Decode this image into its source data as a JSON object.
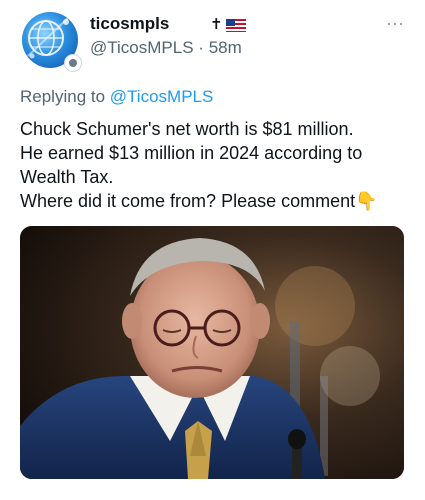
{
  "tweet": {
    "display_name": "ticosmpls",
    "name_badges": "✝",
    "handle": "@TicosMPLS",
    "separator": "·",
    "time": "58m",
    "reply_prefix": "Replying to",
    "reply_mention": "@TicosMPLS",
    "lines": [
      "Chuck Schumer's net worth is $81 million.",
      "He earned $13 million in 2024 according to",
      "Wealth Tax.",
      "Where did it come from? Please comment👇"
    ],
    "more_icon": "⋯",
    "icons": [
      "globe-icon",
      "flag-us-icon",
      "more-icon",
      "point-down-emoji"
    ]
  }
}
